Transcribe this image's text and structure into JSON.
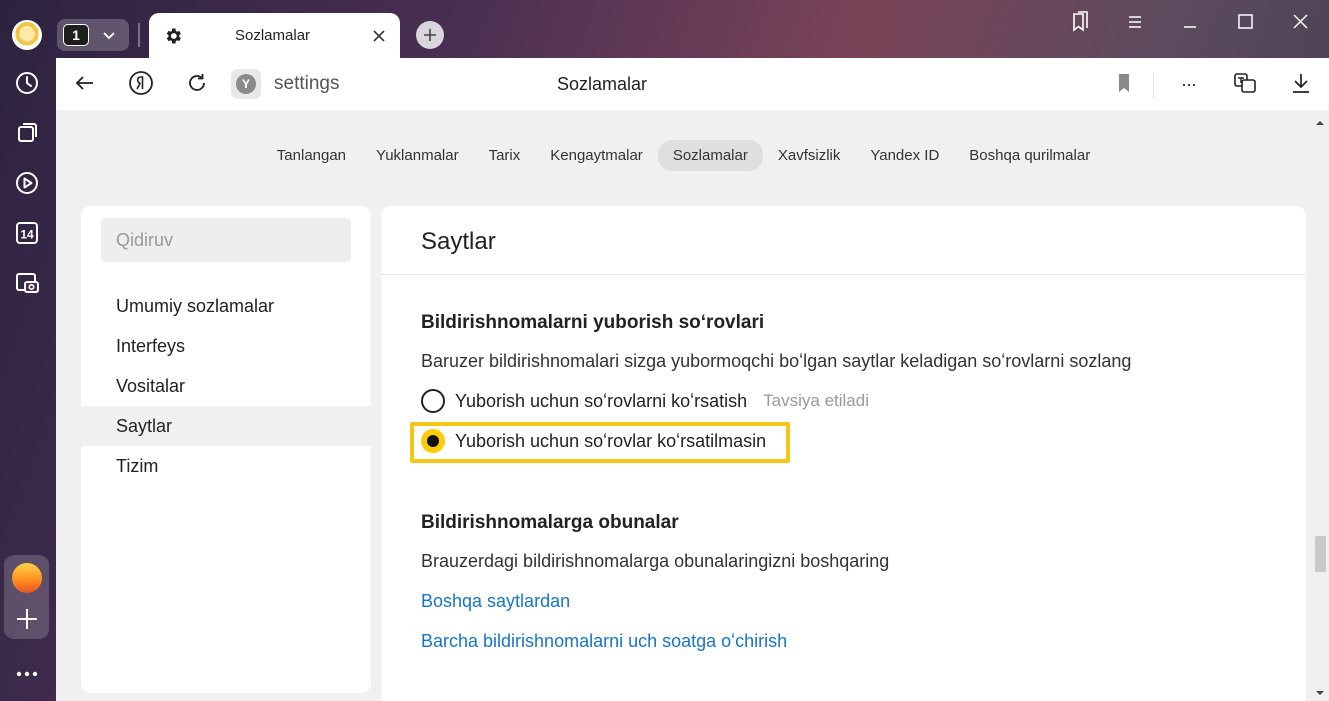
{
  "browser": {
    "tab_count": "1",
    "tab_title": "Sozlamalar"
  },
  "address": {
    "url": "settings",
    "page_title": "Sozlamalar",
    "menu_label": "..."
  },
  "topnav": {
    "items": [
      "Tanlangan",
      "Yuklanmalar",
      "Tarix",
      "Kengaytmalar",
      "Sozlamalar",
      "Xavfsizlik",
      "Yandex ID",
      "Boshqa qurilmalar"
    ],
    "active": "Sozlamalar"
  },
  "sidebar": {
    "search_placeholder": "Qidiruv",
    "items": [
      "Umumiy sozlamalar",
      "Interfeys",
      "Vositalar",
      "Saytlar",
      "Tizim"
    ],
    "active": "Saytlar"
  },
  "panel": {
    "title": "Saytlar",
    "section1": {
      "heading": "Bildirishnomalarni yuborish soʻrovlari",
      "description": "Baruzer bildirishnomalari sizga yubormoqchi boʻlgan saytlar keladigan soʻrovlarni sozlang",
      "option1": "Yuborish uchun soʻrovlarni koʻrsatish",
      "option1_hint": "Tavsiya etiladi",
      "option2": "Yuborish uchun soʻrovlar koʻrsatilmasin",
      "selected": "option2"
    },
    "section2": {
      "heading": "Bildirishnomalarga obunalar",
      "description": "Brauzerdagi bildirishnomalarga obunalaringizni boshqaring",
      "link1": "Boshqa saytlardan",
      "link2": "Barcha bildirishnomalarni uch soatga oʻchirish"
    }
  },
  "calendar_day": "14",
  "colors": {
    "accent": "#ffcc00",
    "link": "#1a73c8",
    "highlight": "#f5c518"
  }
}
